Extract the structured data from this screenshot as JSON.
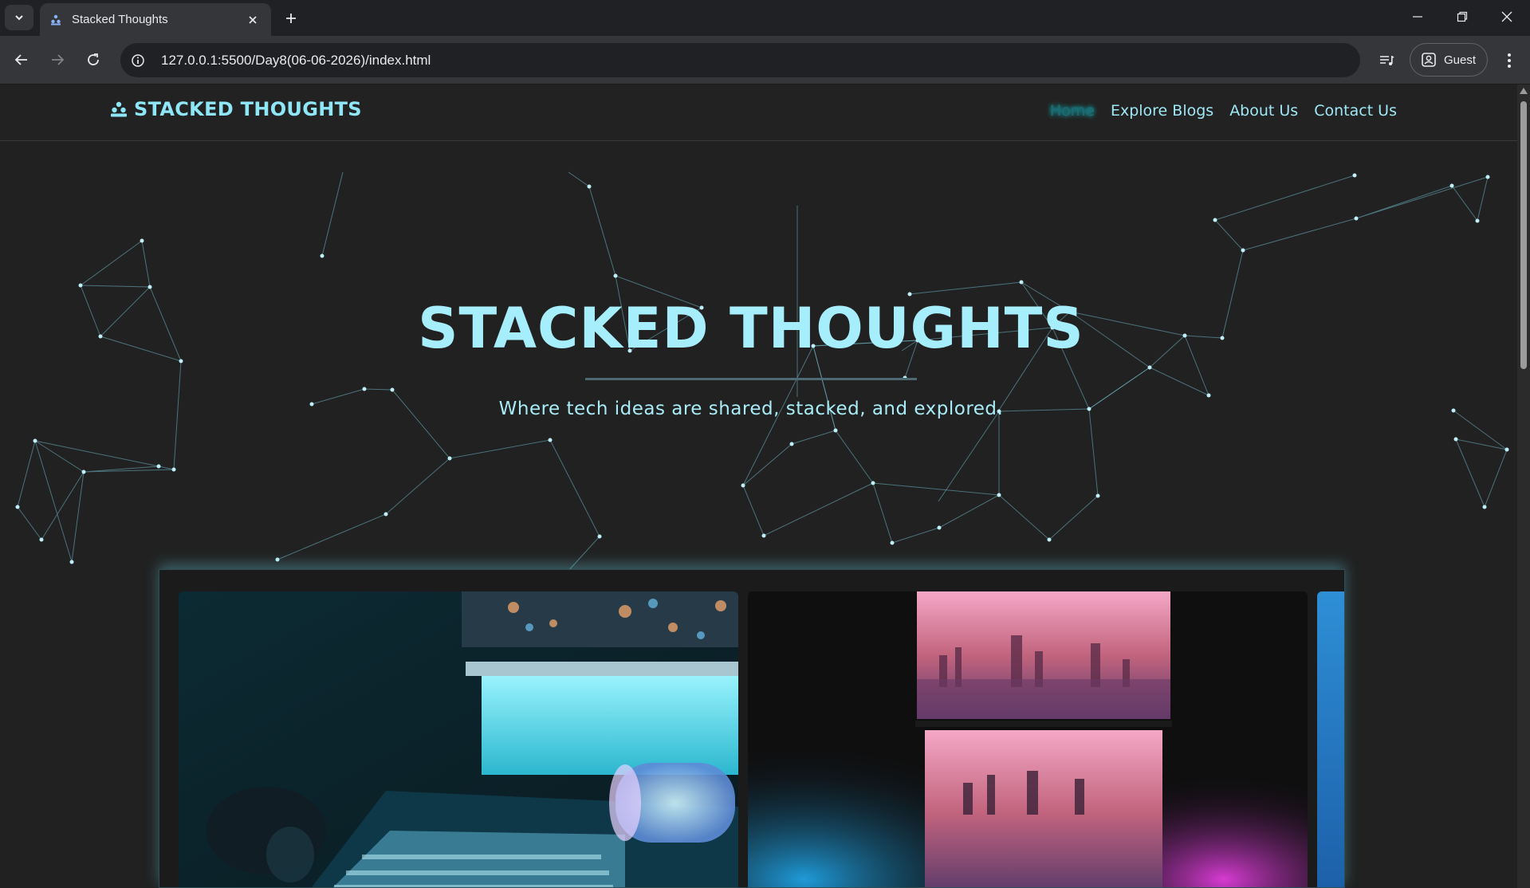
{
  "browser": {
    "tab_title": "Stacked Thoughts",
    "url": "127.0.0.1:5500/Day8(06-06-2026)/index.html",
    "profile_label": "Guest"
  },
  "site": {
    "brand": "STACKED THOUGHTS",
    "nav": [
      {
        "label": "Home",
        "active": true
      },
      {
        "label": "Explore Blogs",
        "active": false
      },
      {
        "label": "About Us",
        "active": false
      },
      {
        "label": "Contact Us",
        "active": false
      }
    ],
    "hero": {
      "title": "STACKED THOUGHTS",
      "subtitle": "Where tech ideas are shared, stacked, and explored."
    },
    "carousel": {
      "cards": [
        {
          "image": "keyboard-setup-image"
        },
        {
          "image": "city-monitors-image"
        },
        {
          "image": "blue-partial-image"
        }
      ]
    }
  },
  "colors": {
    "accent": "#8ee6f7",
    "background": "#212121",
    "network_line": "#6fb8c6"
  }
}
